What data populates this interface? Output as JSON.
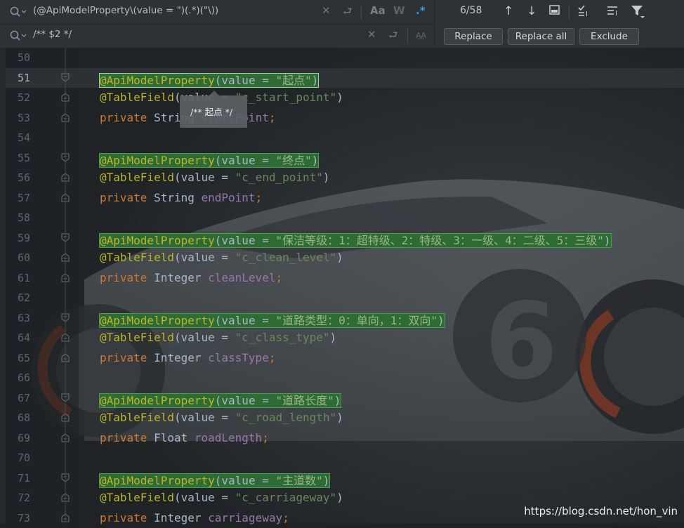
{
  "find_bar": {
    "search_value": "(@ApiModelProperty\\(value = \")(.*)(\"\\))",
    "replace_value": "/** $2 */",
    "match_count": "6/58",
    "match_case_label": "Aa",
    "words_label": "W",
    "regex_label": ".*",
    "preserve_case_label": "A͟A"
  },
  "buttons": {
    "replace": "Replace",
    "replace_all": "Replace all",
    "exclude": "Exclude"
  },
  "tooltip": "/** 起点 */",
  "watermark": "https://blog.csdn.net/hon_vin",
  "editor": {
    "current_line": "51",
    "lines": [
      {
        "num": "50",
        "tokens": []
      },
      {
        "num": "51",
        "tokens": [
          {
            "c": "ann",
            "t": "@ApiModelProperty"
          },
          {
            "c": "pl",
            "t": "("
          },
          {
            "c": "pl",
            "t": "value = "
          },
          {
            "c": "str",
            "t": "\"起点\""
          },
          {
            "c": "pl",
            "t": ")"
          }
        ],
        "highlight": "selected"
      },
      {
        "num": "52",
        "tokens": [
          {
            "c": "ann",
            "t": "@TableField"
          },
          {
            "c": "pl",
            "t": "(value = "
          },
          {
            "c": "str",
            "t": "\"c_start_point\""
          },
          {
            "c": "pl",
            "t": ")"
          }
        ]
      },
      {
        "num": "53",
        "tokens": [
          {
            "c": "kw",
            "t": "private "
          },
          {
            "c": "pl",
            "t": "String "
          },
          {
            "c": "fld",
            "t": "startPoint"
          },
          {
            "c": "kw",
            "t": ";"
          }
        ]
      },
      {
        "num": "54",
        "tokens": []
      },
      {
        "num": "55",
        "tokens": [
          {
            "c": "ann",
            "t": "@ApiModelProperty"
          },
          {
            "c": "pl",
            "t": "("
          },
          {
            "c": "pl",
            "t": "value = "
          },
          {
            "c": "str",
            "t": "\"终点\""
          },
          {
            "c": "pl",
            "t": ")"
          }
        ],
        "highlight": "match"
      },
      {
        "num": "56",
        "tokens": [
          {
            "c": "ann",
            "t": "@TableField"
          },
          {
            "c": "pl",
            "t": "(value = "
          },
          {
            "c": "str",
            "t": "\"c_end_point\""
          },
          {
            "c": "pl",
            "t": ")"
          }
        ]
      },
      {
        "num": "57",
        "tokens": [
          {
            "c": "kw",
            "t": "private "
          },
          {
            "c": "pl",
            "t": "String "
          },
          {
            "c": "fld",
            "t": "endPoint"
          },
          {
            "c": "kw",
            "t": ";"
          }
        ]
      },
      {
        "num": "58",
        "tokens": []
      },
      {
        "num": "59",
        "tokens": [
          {
            "c": "ann",
            "t": "@ApiModelProperty"
          },
          {
            "c": "pl",
            "t": "("
          },
          {
            "c": "pl",
            "t": "value = "
          },
          {
            "c": "str",
            "t": "\"保洁等级：1：超特级、2：特级、3：一级、4：二级、5：三级\""
          },
          {
            "c": "pl",
            "t": ")"
          }
        ],
        "highlight": "match"
      },
      {
        "num": "60",
        "tokens": [
          {
            "c": "ann",
            "t": "@TableField"
          },
          {
            "c": "pl",
            "t": "(value = "
          },
          {
            "c": "str",
            "t": "\"c_clean_level\""
          },
          {
            "c": "pl",
            "t": ")"
          }
        ]
      },
      {
        "num": "61",
        "tokens": [
          {
            "c": "kw",
            "t": "private "
          },
          {
            "c": "pl",
            "t": "Integer "
          },
          {
            "c": "fld",
            "t": "cleanLevel"
          },
          {
            "c": "kw",
            "t": ";"
          }
        ]
      },
      {
        "num": "62",
        "tokens": []
      },
      {
        "num": "63",
        "tokens": [
          {
            "c": "ann",
            "t": "@ApiModelProperty"
          },
          {
            "c": "pl",
            "t": "("
          },
          {
            "c": "pl",
            "t": "value = "
          },
          {
            "c": "str",
            "t": "\"道路类型：0：单向，1：双向\""
          },
          {
            "c": "pl",
            "t": ")"
          }
        ],
        "highlight": "match"
      },
      {
        "num": "64",
        "tokens": [
          {
            "c": "ann",
            "t": "@TableField"
          },
          {
            "c": "pl",
            "t": "(value = "
          },
          {
            "c": "str",
            "t": "\"c_class_type\""
          },
          {
            "c": "pl",
            "t": ")"
          }
        ]
      },
      {
        "num": "65",
        "tokens": [
          {
            "c": "kw",
            "t": "private "
          },
          {
            "c": "pl",
            "t": "Integer "
          },
          {
            "c": "fld",
            "t": "classType"
          },
          {
            "c": "kw",
            "t": ";"
          }
        ]
      },
      {
        "num": "66",
        "tokens": []
      },
      {
        "num": "67",
        "tokens": [
          {
            "c": "ann",
            "t": "@ApiModelProperty"
          },
          {
            "c": "pl",
            "t": "("
          },
          {
            "c": "pl",
            "t": "value = "
          },
          {
            "c": "str",
            "t": "\"道路长度\""
          },
          {
            "c": "pl",
            "t": ")"
          }
        ],
        "highlight": "match"
      },
      {
        "num": "68",
        "tokens": [
          {
            "c": "ann",
            "t": "@TableField"
          },
          {
            "c": "pl",
            "t": "(value = "
          },
          {
            "c": "str",
            "t": "\"c_road_length\""
          },
          {
            "c": "pl",
            "t": ")"
          }
        ]
      },
      {
        "num": "69",
        "tokens": [
          {
            "c": "kw",
            "t": "private "
          },
          {
            "c": "pl",
            "t": "Float "
          },
          {
            "c": "fld",
            "t": "roadLength"
          },
          {
            "c": "kw",
            "t": ";"
          }
        ]
      },
      {
        "num": "70",
        "tokens": []
      },
      {
        "num": "71",
        "tokens": [
          {
            "c": "ann",
            "t": "@ApiModelProperty"
          },
          {
            "c": "pl",
            "t": "("
          },
          {
            "c": "pl",
            "t": "value = "
          },
          {
            "c": "str",
            "t": "\"主道数\""
          },
          {
            "c": "pl",
            "t": ")"
          }
        ],
        "highlight": "match"
      },
      {
        "num": "72",
        "tokens": [
          {
            "c": "ann",
            "t": "@TableField"
          },
          {
            "c": "pl",
            "t": "(value = "
          },
          {
            "c": "str",
            "t": "\"c_carriageway\""
          },
          {
            "c": "pl",
            "t": ")"
          }
        ]
      },
      {
        "num": "73",
        "tokens": [
          {
            "c": "kw",
            "t": "private "
          },
          {
            "c": "pl",
            "t": "Integer "
          },
          {
            "c": "fld",
            "t": "carriageway"
          },
          {
            "c": "kw",
            "t": ";"
          }
        ]
      }
    ]
  }
}
